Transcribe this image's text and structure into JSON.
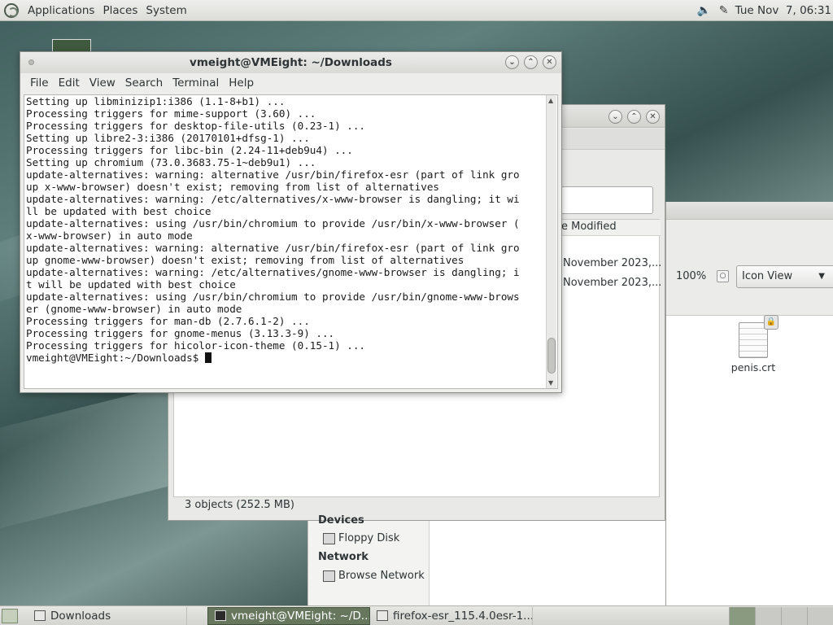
{
  "top_panel": {
    "menus": [
      "Applications",
      "Places",
      "System"
    ],
    "clock": "Tue Nov  7, 06:31",
    "icons": [
      "volume-icon",
      "network-icon"
    ]
  },
  "file_manager": {
    "column_header": "e Modified",
    "rows": [
      "November 2023,...",
      "November 2023,..."
    ],
    "status": "3 objects (252.5 MB)"
  },
  "file_window_right": {
    "zoom": "100%",
    "view_mode": "Icon View",
    "file": "penis.crt"
  },
  "places_sidebar": {
    "devices_heading": "Devices",
    "floppy": "Floppy Disk",
    "network_heading": "Network",
    "browse_network": "Browse Network"
  },
  "terminal": {
    "title": "vmeight@VMEight: ~/Downloads",
    "menus": [
      "File",
      "Edit",
      "View",
      "Search",
      "Terminal",
      "Help"
    ],
    "lines": [
      "Setting up libminizip1:i386 (1.1-8+b1) ...",
      "Processing triggers for mime-support (3.60) ...",
      "Processing triggers for desktop-file-utils (0.23-1) ...",
      "Setting up libre2-3:i386 (20170101+dfsg-1) ...",
      "Processing triggers for libc-bin (2.24-11+deb9u4) ...",
      "Setting up chromium (73.0.3683.75-1~deb9u1) ...",
      "update-alternatives: warning: alternative /usr/bin/firefox-esr (part of link gro",
      "up x-www-browser) doesn't exist; removing from list of alternatives",
      "update-alternatives: warning: /etc/alternatives/x-www-browser is dangling; it wi",
      "ll be updated with best choice",
      "update-alternatives: using /usr/bin/chromium to provide /usr/bin/x-www-browser (",
      "x-www-browser) in auto mode",
      "update-alternatives: warning: alternative /usr/bin/firefox-esr (part of link gro",
      "up gnome-www-browser) doesn't exist; removing from list of alternatives",
      "update-alternatives: warning: /etc/alternatives/gnome-www-browser is dangling; i",
      "t will be updated with best choice",
      "update-alternatives: using /usr/bin/chromium to provide /usr/bin/gnome-www-brows",
      "er (gnome-www-browser) in auto mode",
      "Processing triggers for man-db (2.7.6.1-2) ...",
      "Processing triggers for gnome-menus (3.13.3-9) ...",
      "Processing triggers for hicolor-icon-theme (0.15-1) ..."
    ],
    "prompt": "vmeight@VMEight:~/Downloads$ "
  },
  "taskbar": {
    "tasks": [
      "Downloads",
      "vmeight@VMEight: ~/D...",
      "firefox-esr_115.4.0esr-1..."
    ]
  }
}
